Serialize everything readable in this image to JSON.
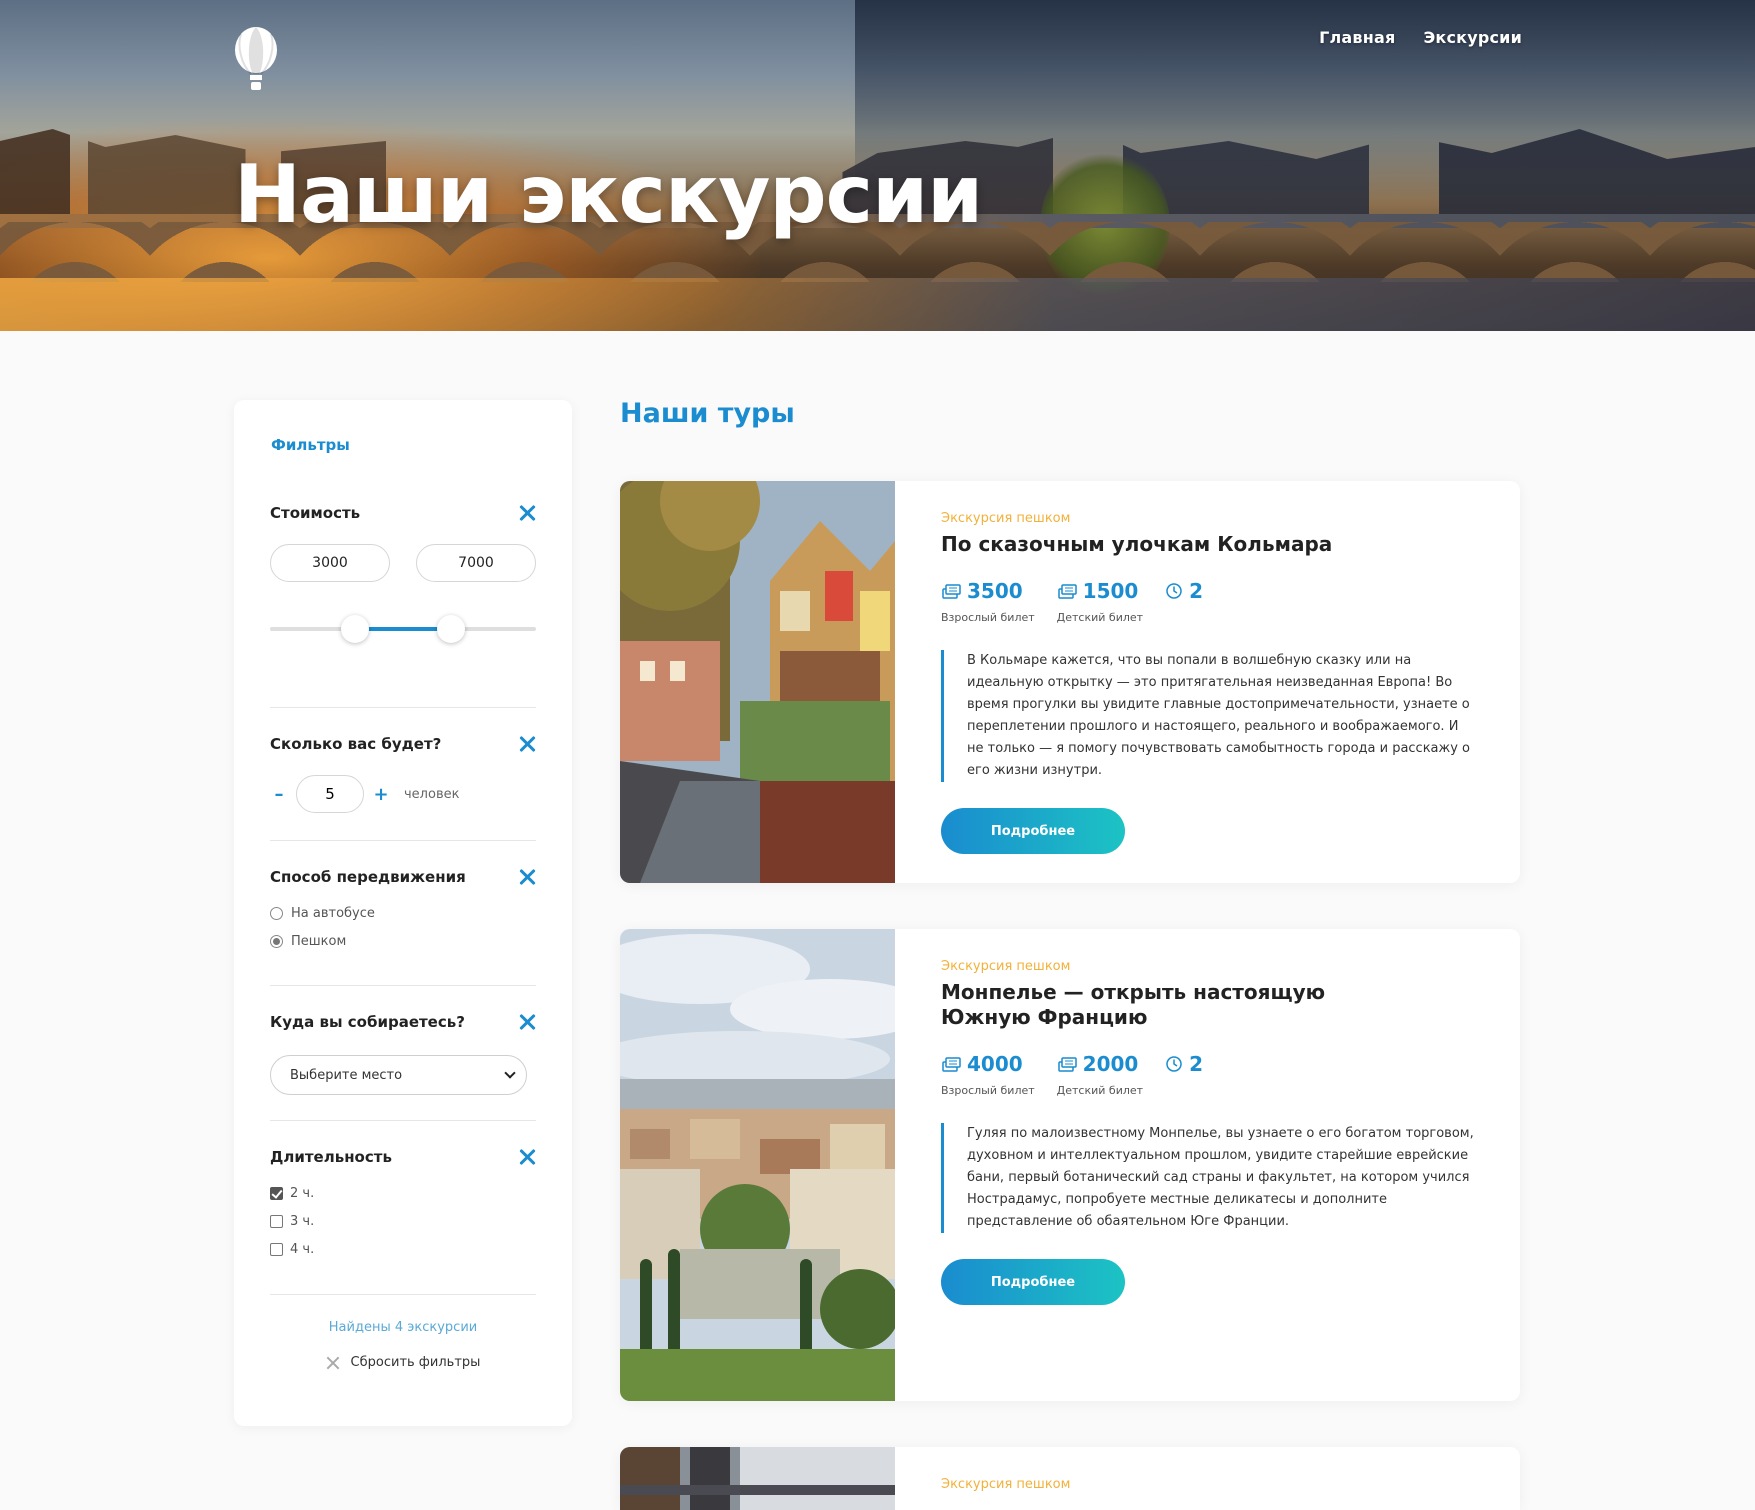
{
  "nav": {
    "home": "Главная",
    "tours": "Экскурсии"
  },
  "hero": {
    "title": "Наши экскурсии"
  },
  "filters": {
    "title": "Фильтры",
    "price": {
      "label": "Стоимость",
      "min": "3000",
      "max": "7000",
      "range_low_fraction": 0.32,
      "range_high_fraction": 0.68
    },
    "people": {
      "label": "Сколько вас будет?",
      "minus": "–",
      "value": "5",
      "plus": "+",
      "unit": "человек"
    },
    "transport": {
      "label": "Способ передвижения",
      "options": [
        "На автобусе",
        "Пешком"
      ],
      "selected": "Пешком"
    },
    "destination": {
      "label": "Куда вы собираетесь?",
      "placeholder": "Выберите место"
    },
    "duration": {
      "label": "Длительность",
      "options": [
        "2 ч.",
        "3 ч.",
        "4 ч."
      ],
      "checked": [
        "2 ч."
      ]
    },
    "found": "Найдены 4 экскурсии",
    "reset": "Сбросить фильтры"
  },
  "tours_title": "Наши туры",
  "tours": [
    {
      "type": "Экскурсия пешком",
      "name": "По сказочным улочкам Кольмара",
      "adult_price": "3500",
      "adult_label": "Взрослый билет",
      "child_price": "1500",
      "child_label": "Детский билет",
      "duration": "2",
      "description": "В Кольмаре кажется, что вы попали в волшебную сказку или на идеальную открытку — это притягательная неизведанная Европа! Во время прогулки вы увидите главные достопримечательности, узнаете о переплетении прошлого и настоящего, реального и воображаемого. И не только — я помогу почувствовать самобытность города и расскажу о его жизни изнутри.",
      "button": "Подробнее"
    },
    {
      "type": "Экскурсия пешком",
      "name": "Монпелье — открыть настоящую Южную Францию",
      "adult_price": "4000",
      "adult_label": "Взрослый билет",
      "child_price": "2000",
      "child_label": "Детский билет",
      "duration": "2",
      "description": "Гуляя по малоизвестному Монпелье, вы узнаете о его богатом торговом, духовном и интеллектуальном прошлом, увидите старейшие еврейские бани, первый ботанический сад страны и факультет, на котором учился Нострадамус, попробуете местные деликатесы и дополните представление об обаятельном Юге Франции.",
      "button": "Подробнее"
    },
    {
      "type": "Экскурсия пешком"
    }
  ],
  "colors": {
    "accent": "#1a8ccf",
    "accent_end": "#1cc3c4",
    "tag": "#f2b13a"
  }
}
